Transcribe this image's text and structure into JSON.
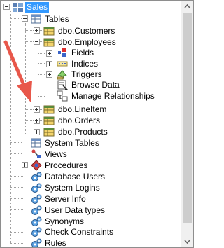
{
  "tree": {
    "root_label": "Sales",
    "tables_label": "Tables",
    "customers_label": "dbo.Customers",
    "employees_label": "dbo.Employees",
    "fields_label": "Fields",
    "indices_label": "Indices",
    "triggers_label": "Triggers",
    "browse_data_label": "Browse Data",
    "manage_relationships_label": "Manage Relationships",
    "lineitem_label": "dbo.LineItem",
    "orders_label": "dbo.Orders",
    "products_label": "dbo.Products",
    "system_tables_label": "System Tables",
    "views_label": "Views",
    "procedures_label": "Procedures",
    "database_users_label": "Database Users",
    "system_logins_label": "System Logins",
    "server_info_label": "Server Info",
    "user_data_types_label": "User Data types",
    "synonyms_label": "Synonyms",
    "check_constraints_label": "Check Constraints",
    "rules_label": "Rules"
  },
  "colors": {
    "selection": "#3399ff",
    "annotation_arrow": "#e8574a"
  },
  "icons": {
    "database": "database-icon",
    "table": "table-icon",
    "fields": "fields-icon",
    "indices": "indices-icon",
    "triggers": "triggers-icon",
    "browse": "browse-data-icon",
    "relationships": "relationships-icon",
    "gear": "gear-icon",
    "views": "views-icon",
    "procedures": "procedures-icon"
  }
}
